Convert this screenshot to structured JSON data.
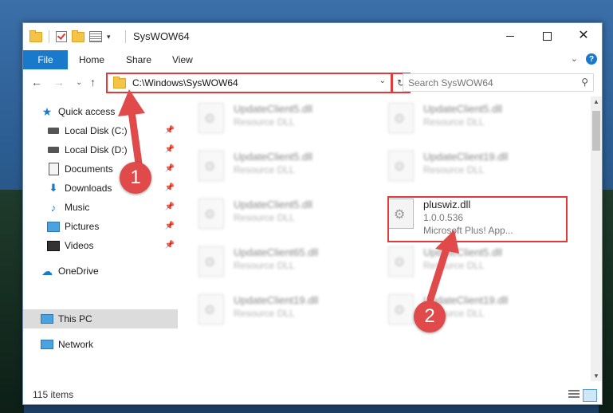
{
  "window": {
    "title": "SysWOW64"
  },
  "ribbon": {
    "tabs": [
      "File",
      "Home",
      "Share",
      "View"
    ]
  },
  "address": {
    "path": "C:\\Windows\\SysWOW64"
  },
  "search": {
    "placeholder": "Search SysWOW64"
  },
  "sidebar": {
    "items": [
      {
        "label": "Quick access",
        "icon": "star-icon"
      },
      {
        "label": "Local Disk (C:)",
        "icon": "drive-icon",
        "pinned": true
      },
      {
        "label": "Local Disk (D:)",
        "icon": "drive-icon",
        "pinned": true
      },
      {
        "label": "Documents",
        "icon": "documents-icon",
        "pinned": true
      },
      {
        "label": "Downloads",
        "icon": "download-icon",
        "pinned": true
      },
      {
        "label": "Music",
        "icon": "music-icon",
        "pinned": true
      },
      {
        "label": "Pictures",
        "icon": "pictures-icon",
        "pinned": true
      },
      {
        "label": "Videos",
        "icon": "videos-icon",
        "pinned": true
      },
      {
        "label": "OneDrive",
        "icon": "cloud-icon"
      },
      {
        "label": "This PC",
        "icon": "computer-icon",
        "selected": true
      },
      {
        "label": "Network",
        "icon": "network-icon"
      }
    ]
  },
  "files": [
    {
      "name": "UpdateClient5.dll",
      "sub": "Resource DLL",
      "blurred": true
    },
    {
      "name": "UpdateClient5.dll",
      "sub": "Resource DLL",
      "blurred": true
    },
    {
      "name": "UpdateClient5.dll",
      "sub": "Resource DLL",
      "blurred": true
    },
    {
      "name": "UpdateClient19.dll",
      "sub": "Resource DLL",
      "blurred": true
    },
    {
      "name": "UpdateClient5.dll",
      "sub": "Resource DLL",
      "blurred": true
    },
    {
      "name": "pluswiz.dll",
      "version": "1.0.0.536",
      "sub": "Microsoft Plus! App...",
      "blurred": false
    },
    {
      "name": "UpdateClient65.dll",
      "sub": "Resource DLL",
      "blurred": true
    },
    {
      "name": "UpdateClient5.dll",
      "sub": "Resource DLL",
      "blurred": true
    },
    {
      "name": "UpdateClient19.dll",
      "sub": "Resource DLL",
      "blurred": true
    },
    {
      "name": "UpdateClient19.dll",
      "sub": "Resource DLL",
      "blurred": true
    }
  ],
  "status": {
    "item_count": "115 items"
  },
  "annotations": {
    "badge1": "1",
    "badge2": "2",
    "color": "#e04a4a"
  }
}
